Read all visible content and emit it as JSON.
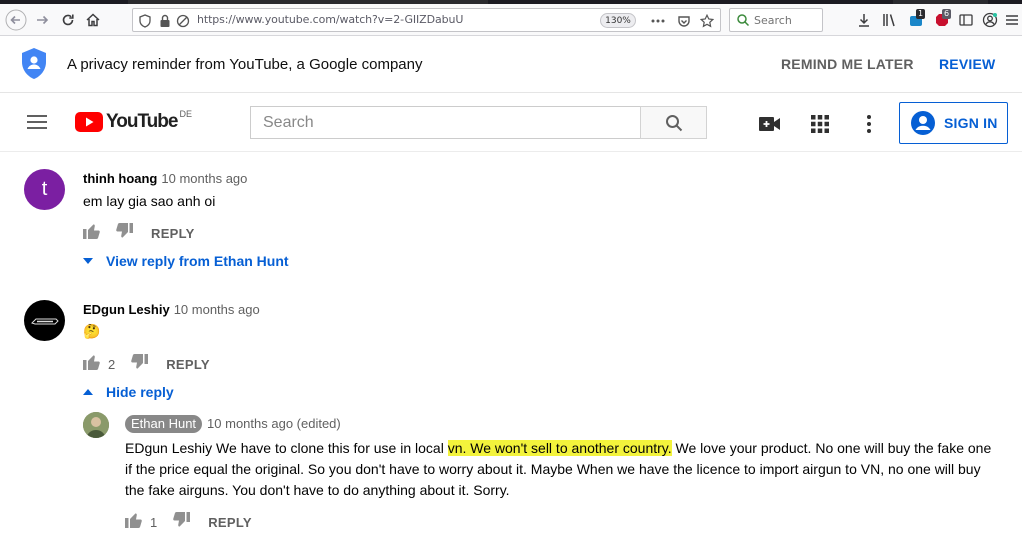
{
  "browser": {
    "url": "https://www.youtube.com/watch?v=2-GIIZDabuU",
    "zoom": "130%",
    "search_placeholder": "Search",
    "badge_a": "1",
    "badge_b": "6"
  },
  "privacy_banner": {
    "message": "A privacy reminder from YouTube, a Google company",
    "remind_later": "REMIND ME LATER",
    "review": "REVIEW"
  },
  "header": {
    "logo_text": "YouTube",
    "country_code": "DE",
    "search_placeholder": "Search",
    "sign_in": "SIGN IN"
  },
  "comments": [
    {
      "avatar_letter": "t",
      "author": "thinh hoang",
      "time": "10 months ago",
      "text": "em lay gia sao anh oi",
      "likes": "",
      "reply_label": "REPLY",
      "toggle": "View reply from Ethan Hunt"
    },
    {
      "author": "EDgun Leshiy",
      "time": "10 months ago",
      "text": "🤔",
      "likes": "2",
      "reply_label": "REPLY",
      "toggle": "Hide reply"
    }
  ],
  "reply": {
    "author": "Ethan Hunt",
    "time": "10 months ago (edited)",
    "text_before": "EDgun Leshiy We have to clone this for use in local ",
    "text_highlight": "vn. We won't sell to another country.",
    "text_after": " We love your product. No one will buy the fake one if the price equal the original. So you don't have to worry about it. Maybe When we have the licence to import airgun to VN, no one will buy the fake airguns. You don't have to do anything about it. Sorry.",
    "likes": "1",
    "reply_label": "REPLY"
  },
  "colors": {
    "link_blue": "#065fd4",
    "avatar_purple": "#7b1fa2",
    "highlight": "#f3f33c"
  }
}
